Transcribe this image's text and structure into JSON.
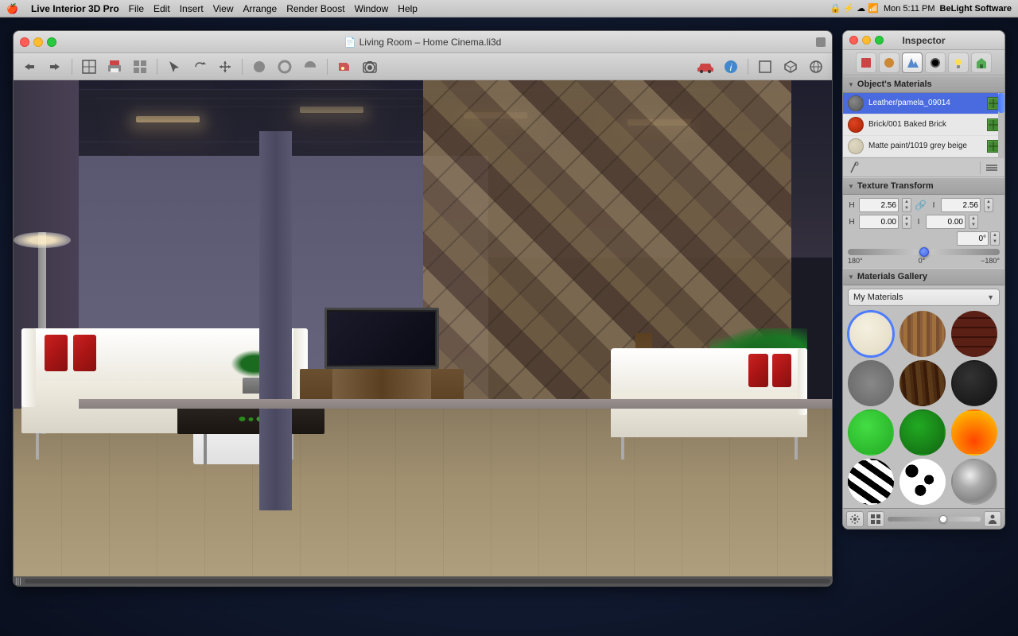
{
  "menubar": {
    "apple": "🍎",
    "items": [
      "Live Interior 3D Pro",
      "File",
      "Edit",
      "Insert",
      "View",
      "Arrange",
      "Render Boost",
      "Window",
      "Help"
    ],
    "right": {
      "status_icons": "🔒 ⚡ ☁",
      "time": "Mon 5:11 PM",
      "brand": "BeLight Software"
    }
  },
  "main_window": {
    "title": "Living Room – Home Cinema.li3d",
    "traffic_lights": [
      "close",
      "minimize",
      "maximize"
    ]
  },
  "toolbar": {
    "nav_back": "←",
    "nav_forward": "→",
    "tools": [
      "⊞",
      "🖨",
      "📋",
      "↖",
      "↻",
      "⊕",
      "⬤",
      "⊙",
      "◯",
      "✂",
      "📷"
    ],
    "right_tools": [
      "🚗",
      "ℹ",
      "⊡",
      "🏠",
      "🌐"
    ]
  },
  "inspector": {
    "title": "Inspector",
    "traffic_lights": [
      "close",
      "minimize",
      "maximize"
    ],
    "tabs": [
      {
        "id": "materials-tab",
        "icon": "🧱",
        "active": false
      },
      {
        "id": "color-tab",
        "icon": "🔶",
        "active": false
      },
      {
        "id": "paint-tab",
        "icon": "🖌",
        "active": true
      },
      {
        "id": "texture-tab",
        "icon": "⬤",
        "active": false
      },
      {
        "id": "light-tab",
        "icon": "💡",
        "active": false
      },
      {
        "id": "house-tab",
        "icon": "🏠",
        "active": false
      }
    ],
    "objects_materials": {
      "section_title": "Object's Materials",
      "materials": [
        {
          "name": "Leather/pamela_09014",
          "swatch_color": "#6a6a6a",
          "swatch_type": "leather"
        },
        {
          "name": "Brick/001 Baked Brick",
          "swatch_color": "#cc3320",
          "swatch_type": "brick"
        },
        {
          "name": "Matte paint/1019 grey beige",
          "swatch_color": "#d4c8b0",
          "swatch_type": "paint"
        }
      ]
    },
    "texture_transform": {
      "section_title": "Texture Transform",
      "scale_x_label": "H",
      "scale_x_value": "2.56",
      "scale_y_label": "I",
      "scale_y_value": "2.56",
      "offset_x_label": "H",
      "offset_x_value": "0.00",
      "offset_y_label": "I",
      "offset_y_value": "0.00",
      "rotation_label": "0°",
      "rotation_min": "180°",
      "rotation_mid": "0°",
      "rotation_max": "−180°"
    },
    "materials_gallery": {
      "section_title": "Materials Gallery",
      "dropdown_label": "My Materials",
      "materials": [
        {
          "id": "cream",
          "type": "cream",
          "selected": true
        },
        {
          "id": "wood-light",
          "type": "wood-light"
        },
        {
          "id": "brick",
          "type": "brick"
        },
        {
          "id": "concrete",
          "type": "concrete"
        },
        {
          "id": "wood-dark",
          "type": "wood-dark"
        },
        {
          "id": "black",
          "type": "black"
        },
        {
          "id": "green-bright",
          "type": "green-bright"
        },
        {
          "id": "green-dark",
          "type": "green-dark"
        },
        {
          "id": "fire",
          "type": "fire"
        },
        {
          "id": "zebra",
          "type": "zebra"
        },
        {
          "id": "spots",
          "type": "spots"
        },
        {
          "id": "chrome",
          "type": "chrome"
        }
      ]
    }
  }
}
